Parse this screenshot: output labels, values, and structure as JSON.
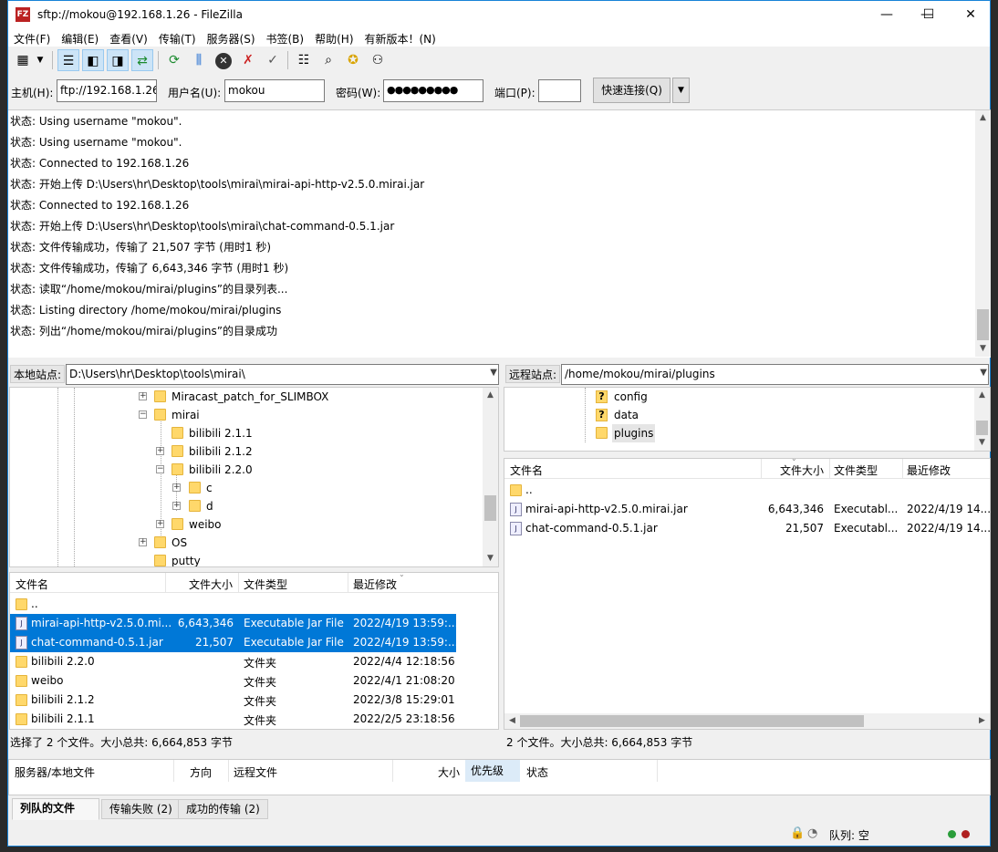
{
  "title": "sftp://mokou@192.168.1.26 - FileZilla",
  "app_icon": "FZ",
  "window_controls": {
    "minimize": "—",
    "maximize": "☐",
    "close": "✕"
  },
  "menu": [
    "文件(F)",
    "编辑(E)",
    "查看(V)",
    "传输(T)",
    "服务器(S)",
    "书签(B)",
    "帮助(H)",
    "有新版本！(N)"
  ],
  "quickconnect": {
    "host_label": "主机(H):",
    "host_value": "ftp://192.168.1.26",
    "user_label": "用户名(U):",
    "user_value": "mokou",
    "pass_label": "密码(W):",
    "pass_value": "●●●●●●●●●",
    "port_label": "端口(P):",
    "port_value": "",
    "connect_label": "快速连接(Q)",
    "dropdown_arrow": "▼"
  },
  "log_lines": [
    "状态: Using username \"mokou\".",
    "状态: Using username \"mokou\".",
    "状态: Connected to 192.168.1.26",
    "状态: 开始上传 D:\\Users\\hr\\Desktop\\tools\\mirai\\mirai-api-http-v2.5.0.mirai.jar",
    "状态: Connected to 192.168.1.26",
    "状态: 开始上传 D:\\Users\\hr\\Desktop\\tools\\mirai\\chat-command-0.5.1.jar",
    "状态: 文件传输成功，传输了 21,507 字节 (用时1 秒)",
    "状态: 文件传输成功，传输了 6,643,346 字节 (用时1 秒)",
    "状态: 读取“/home/mokou/mirai/plugins”的目录列表...",
    "状态: Listing directory /home/mokou/mirai/plugins",
    "状态: 列出“/home/mokou/mirai/plugins”的目录成功"
  ],
  "local": {
    "label": "本地站点:",
    "path": "D:\\Users\\hr\\Desktop\\tools\\mirai\\",
    "tree": [
      "Miracast_patch_for_SLIMBOX",
      "mirai",
      "bilibili 2.1.1",
      "bilibili 2.1.2",
      "bilibili 2.2.0",
      "c",
      "d",
      "weibo",
      "OS",
      "putty"
    ],
    "columns": {
      "name": "文件名",
      "size": "文件大小",
      "type": "文件类型",
      "modified": "最近修改"
    },
    "parent": "..",
    "files": [
      {
        "name": "mirai-api-http-v2.5.0.mi...",
        "size": "6,643,346",
        "type": "Executable Jar File",
        "modified": "2022/4/19 13:59:..."
      },
      {
        "name": "chat-command-0.5.1.jar",
        "size": "21,507",
        "type": "Executable Jar File",
        "modified": "2022/4/19 13:59:..."
      },
      {
        "name": "bilibili 2.2.0",
        "size": "",
        "type": "文件夹",
        "modified": "2022/4/4 12:18:56"
      },
      {
        "name": "weibo",
        "size": "",
        "type": "文件夹",
        "modified": "2022/4/1 21:08:20"
      },
      {
        "name": "bilibili 2.1.2",
        "size": "",
        "type": "文件夹",
        "modified": "2022/3/8 15:29:01"
      },
      {
        "name": "bilibili 2.1.1",
        "size": "",
        "type": "文件夹",
        "modified": "2022/2/5 23:18:56"
      }
    ],
    "status": "选择了 2 个文件。大小总共: 6,664,853 字节"
  },
  "remote": {
    "label": "远程站点:",
    "path": "/home/mokou/mirai/plugins",
    "tree": [
      "config",
      "data",
      "plugins"
    ],
    "columns": {
      "name": "文件名",
      "size": "文件大小",
      "type": "文件类型",
      "modified": "最近修改"
    },
    "parent": "..",
    "files": [
      {
        "name": "mirai-api-http-v2.5.0.mirai.jar",
        "size": "6,643,346",
        "type": "Executabl...",
        "modified": "2022/4/19 14..."
      },
      {
        "name": "chat-command-0.5.1.jar",
        "size": "21,507",
        "type": "Executabl...",
        "modified": "2022/4/19 14..."
      }
    ],
    "status": "2 个文件。大小总共: 6,664,853 字节"
  },
  "queue": {
    "columns": [
      "服务器/本地文件",
      "方向",
      "远程文件",
      "大小",
      "优先级",
      "状态"
    ]
  },
  "tabs": [
    "列队的文件",
    "传输失败 (2)",
    "成功的传输 (2)"
  ],
  "bottom_status": {
    "queue": "队列: 空"
  },
  "colors": {
    "selection": "#0078d7",
    "title_accent": "#1883d7"
  },
  "toolbar_icons": [
    "site-manager-icon",
    "dropdown-arrow-icon",
    "toggle-log-icon",
    "toggle-local-tree-icon",
    "toggle-remote-tree-icon",
    "toggle-queue-icon",
    "refresh-icon",
    "process-queue-icon",
    "cancel-icon",
    "disconnect-icon",
    "reconnect-icon",
    "directory-listing-filter-icon",
    "search-files-icon",
    "sync-browse-icon",
    "compare-dirs-icon"
  ]
}
